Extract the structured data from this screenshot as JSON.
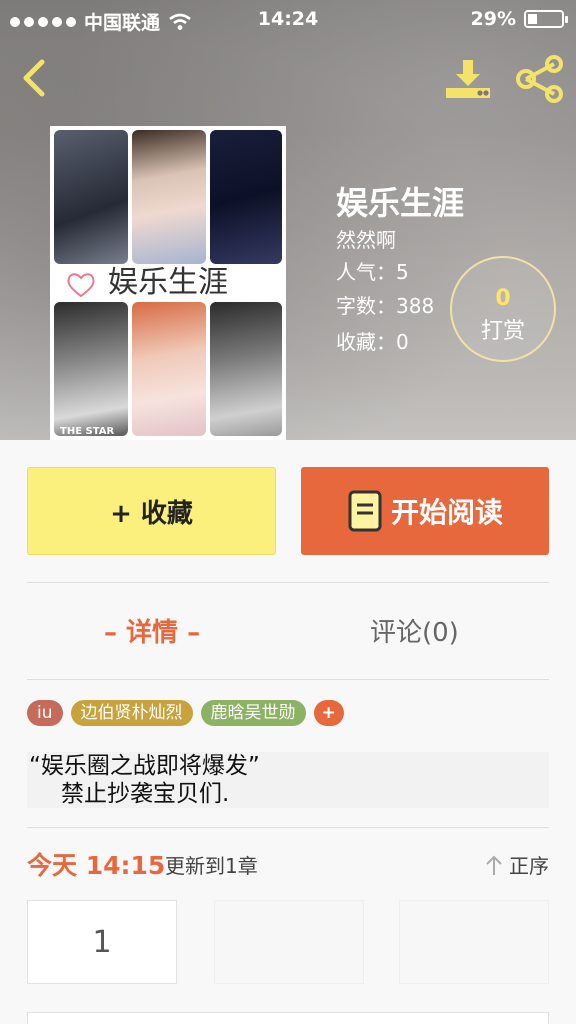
{
  "status_bar": {
    "carrier": "中国联通",
    "time": "14:24",
    "battery": "29%"
  },
  "colors": {
    "accent": "#e8683d",
    "favorite_button": "#fcf07c",
    "tip_count": "#ffe46b"
  },
  "icons": {
    "back": "chevron-left-icon",
    "download": "download-icon",
    "share": "share-icon",
    "read": "book-icon",
    "sort": "arrow-up-icon"
  },
  "book": {
    "cover_title": "娱乐生涯",
    "cover_caption": "THE STAR",
    "title": "娱乐生涯",
    "author": "然然啊",
    "popularity": "人气：5",
    "word_count": "字数：388",
    "favorites": "收藏：0"
  },
  "tip": {
    "count": "0",
    "label": "打赏"
  },
  "actions": {
    "favorite": "+ 收藏",
    "read": "开始阅读"
  },
  "tabs": {
    "detail": "– 详情 –",
    "comments": "评论(0)"
  },
  "tags": [
    {
      "label": "iu"
    },
    {
      "label": "边伯贤朴灿烈"
    },
    {
      "label": "鹿晗吴世勋"
    },
    {
      "label": "+"
    }
  ],
  "description": {
    "line1": "“娱乐圈之战即将爆发”",
    "line2": "禁止抄袭宝贝们."
  },
  "update": {
    "when": "今天 14:15",
    "text": "更新到1章",
    "sort_label": "正序"
  },
  "chapters": [
    {
      "label": "1"
    }
  ]
}
